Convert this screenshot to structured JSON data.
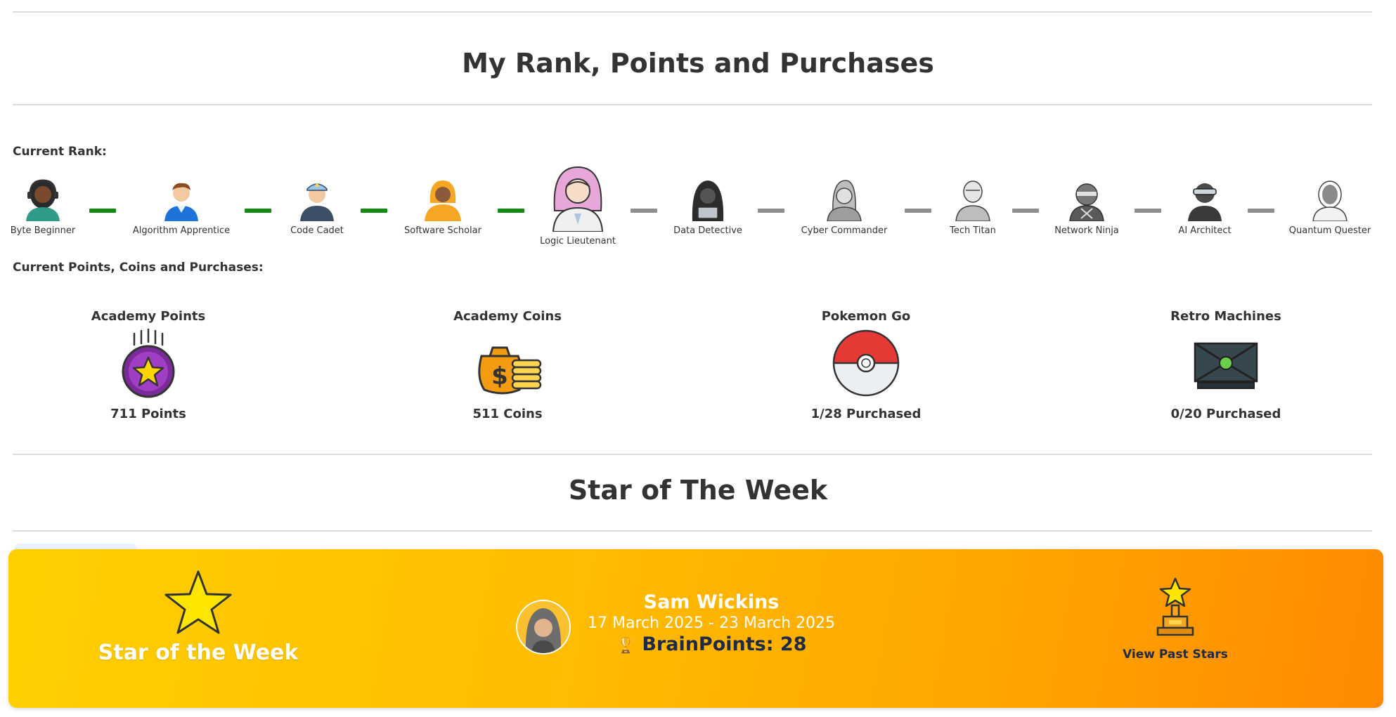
{
  "page": {
    "title": "My Rank, Points and Purchases",
    "current_rank_label": "Current Rank:",
    "points_section_label": "Current Points, Coins and Purchases:"
  },
  "ranks": [
    {
      "label": "Byte Beginner",
      "achieved": true,
      "current": false
    },
    {
      "label": "Algorithm Apprentice",
      "achieved": true,
      "current": false
    },
    {
      "label": "Code Cadet",
      "achieved": true,
      "current": false
    },
    {
      "label": "Software Scholar",
      "achieved": true,
      "current": false
    },
    {
      "label": "Logic Lieutenant",
      "achieved": true,
      "current": true
    },
    {
      "label": "Data Detective",
      "achieved": false,
      "current": false
    },
    {
      "label": "Cyber Commander",
      "achieved": false,
      "current": false
    },
    {
      "label": "Tech Titan",
      "achieved": false,
      "current": false
    },
    {
      "label": "Network Ninja",
      "achieved": false,
      "current": false
    },
    {
      "label": "AI Architect",
      "achieved": false,
      "current": false
    },
    {
      "label": "Quantum Quester",
      "achieved": false,
      "current": false
    }
  ],
  "stats": [
    {
      "title": "Academy Points",
      "value": "711 Points",
      "icon": "medal-star-icon"
    },
    {
      "title": "Academy Coins",
      "value": "511 Coins",
      "icon": "money-bag-coins-icon"
    },
    {
      "title": "Pokemon Go",
      "value": "1/28 Purchased",
      "icon": "pokeball-icon"
    },
    {
      "title": "Retro Machines",
      "value": "0/20 Purchased",
      "icon": "retro-console-icon"
    }
  ],
  "star_of_week": {
    "section_title": "Star of The Week",
    "banner_caption": "Star of the Week",
    "winner_name": "Sam Wickins",
    "dates": "17 March 2025 - 23 March 2025",
    "trophy_glyph": "🏆",
    "brainpoints": "BrainPoints: 28",
    "past_stars_label": "View Past Stars"
  },
  "colors": {
    "connector_done": "#138a13",
    "connector_todo": "#8e8e8e",
    "banner_start": "#ffd000",
    "banner_end": "#ff8a00"
  }
}
